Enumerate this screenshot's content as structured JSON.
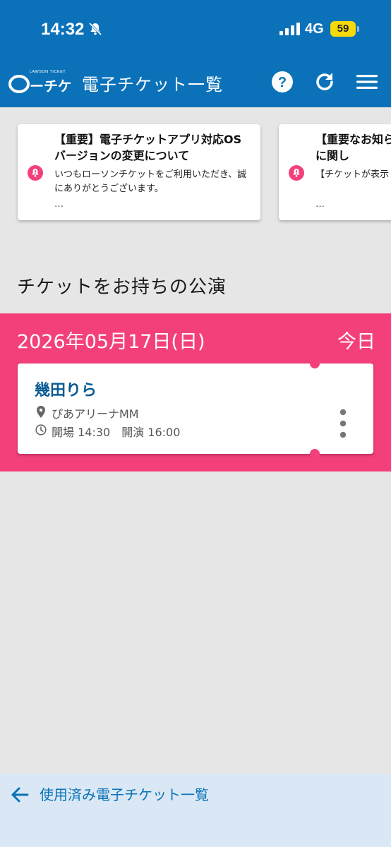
{
  "status_bar": {
    "time": "14:32",
    "network": "4G",
    "battery": "59",
    "icons": [
      "bell-off-icon",
      "signal-icon",
      "battery-icon"
    ]
  },
  "header": {
    "logo_small": "LAWSON TICKET",
    "logo": "ローチケ",
    "title": "電子チケット一覧",
    "icons": [
      "help-icon",
      "refresh-icon",
      "menu-icon"
    ],
    "accent_color": "#0b72b9"
  },
  "notices": [
    {
      "title": "【重要】電子チケットアプリ対応OSバージョンの変更について",
      "body": "いつもローソンチケットをご利用いただき、誠にありがとうございます。",
      "more": "…"
    },
    {
      "title": "【重要なお知らせ】の表示に関し",
      "body": "【チケットが表示 下部リンクより",
      "more": "…"
    }
  ],
  "section": {
    "heading": "チケットをお持ちの公演"
  },
  "date_group": {
    "date": "2026年05月17日(日)",
    "label": "今日",
    "band_color": "#f4407a"
  },
  "ticket": {
    "name": "幾田りら",
    "venue": "ぴあアリーナMM",
    "times": "開場 14:30　開演 16:00"
  },
  "footer": {
    "link": "使用済み電子チケット一覧"
  }
}
